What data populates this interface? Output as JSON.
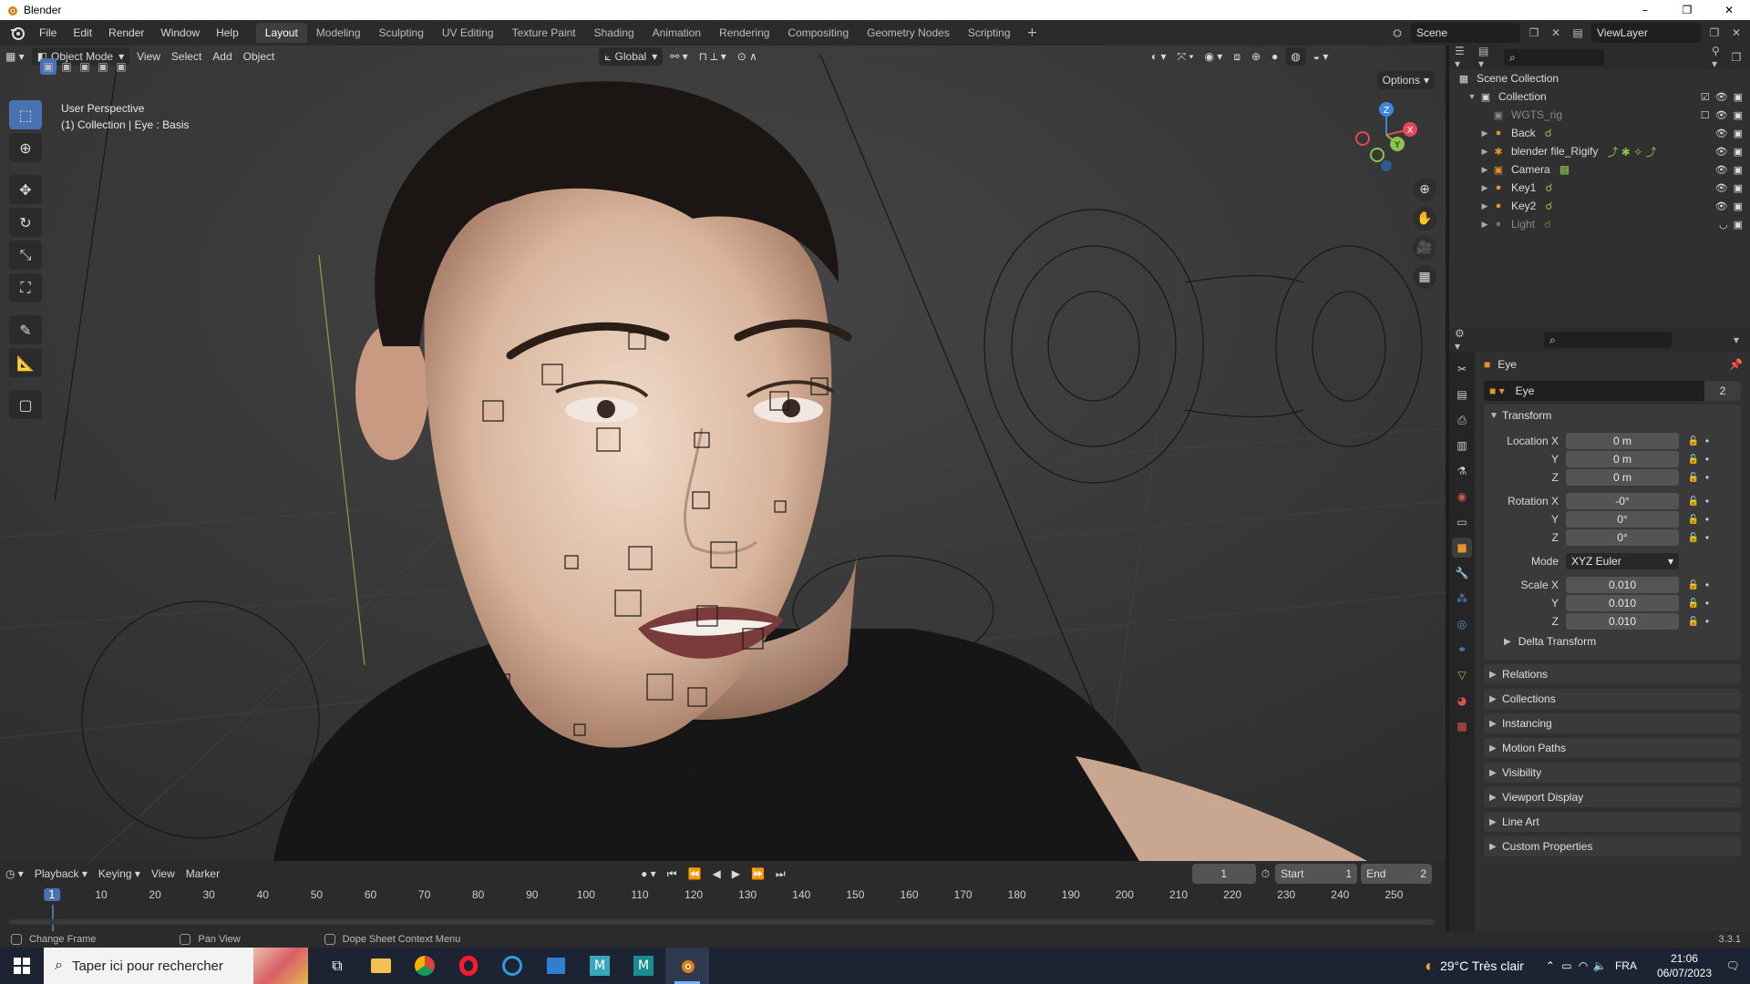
{
  "window": {
    "title": "Blender",
    "minimize": "–",
    "maximize": "❐",
    "close": "✕"
  },
  "menu": [
    "File",
    "Edit",
    "Render",
    "Window",
    "Help"
  ],
  "workspaces": [
    "Layout",
    "Modeling",
    "Sculpting",
    "UV Editing",
    "Texture Paint",
    "Shading",
    "Animation",
    "Rendering",
    "Compositing",
    "Geometry Nodes",
    "Scripting"
  ],
  "workspace_add": "+",
  "scene": {
    "label": "Scene",
    "viewlayer": "ViewLayer"
  },
  "viewport": {
    "mode": "Object Mode",
    "menus": [
      "View",
      "Select",
      "Add",
      "Object"
    ],
    "orientation": "Global",
    "options": "Options",
    "info_line1": "User Perspective",
    "info_line2": "(1) Collection | Eye : Basis",
    "gizmo": {
      "x": "X",
      "y": "Y",
      "z": "Z"
    }
  },
  "timeline": {
    "menus": [
      "Playback",
      "Keying",
      "View",
      "Marker"
    ],
    "current_frame": "1",
    "start_label": "Start",
    "start": "1",
    "end_label": "End",
    "end": "2",
    "ruler": [
      "10",
      "20",
      "30",
      "40",
      "50",
      "60",
      "70",
      "80",
      "90",
      "100",
      "110",
      "120",
      "130",
      "140",
      "150",
      "160",
      "170",
      "180",
      "190",
      "200",
      "210",
      "220",
      "230",
      "240",
      "250"
    ]
  },
  "status": {
    "hint1": "Change Frame",
    "hint2": "Pan View",
    "hint3": "Dope Sheet Context Menu",
    "version": "3.3.1"
  },
  "outliner": {
    "root": "Scene Collection",
    "collection": "Collection",
    "items": [
      {
        "name": "WGTS_rig",
        "dim": true
      },
      {
        "name": "Back",
        "dim": false
      },
      {
        "name": "blender file_Rigify",
        "dim": false
      },
      {
        "name": "Camera",
        "dim": false
      },
      {
        "name": "Key1",
        "dim": false
      },
      {
        "name": "Key2",
        "dim": false
      },
      {
        "name": "Light",
        "dim": true
      }
    ]
  },
  "properties": {
    "object_name": "Eye",
    "data_name": "Eye",
    "users": "2",
    "transform": {
      "title": "Transform",
      "location_label": "Location X",
      "location": [
        "0 m",
        "0 m",
        "0 m"
      ],
      "rotation_label": "Rotation X",
      "rotation": [
        "-0°",
        "0°",
        "0°"
      ],
      "mode_label": "Mode",
      "mode": "XYZ Euler",
      "scale_label": "Scale X",
      "scale": [
        "0.010",
        "0.010",
        "0.010"
      ],
      "y": "Y",
      "z": "Z",
      "delta": "Delta Transform"
    },
    "panels": [
      "Relations",
      "Collections",
      "Instancing",
      "Motion Paths",
      "Visibility",
      "Viewport Display",
      "Line Art",
      "Custom Properties"
    ]
  },
  "taskbar": {
    "search_placeholder": "Taper ici pour rechercher",
    "weather": "29°C  Très clair",
    "lang": "FRA",
    "time": "21:06",
    "date": "06/07/2023"
  },
  "colors": {
    "accent": "#4a72b0",
    "axis_x": "#e24a5a",
    "axis_y": "#8bc34a",
    "axis_z": "#3f86e0",
    "object_orange": "#e8922b"
  }
}
